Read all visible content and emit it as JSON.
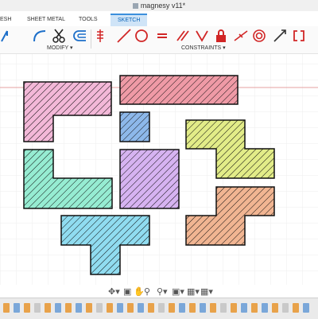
{
  "title": "magnesy v11*",
  "tabs": {
    "solid": "ESH",
    "sheet_metal": "SHEET METAL",
    "tools": "TOOLS",
    "sketch": "SKETCH"
  },
  "toolbar": {
    "modify_label": "MODIFY ▾",
    "constraints_label": "CONSTRAINTS ▾",
    "icons": [
      "line-icon",
      "arc-icon",
      "scissors-icon",
      "offset-icon",
      "pattern-icon",
      "circle-icon",
      "equal-icon",
      "parallel-icon",
      "perpendicular-icon",
      "lock-icon",
      "concentric-icon",
      "midpoint-icon",
      "symmetric-icon"
    ]
  },
  "colors": {
    "pink": "#f3b8d8",
    "red": "#ef9aa6",
    "blue_small": "#8db8ea",
    "yellow": "#e2ec88",
    "teal": "#96ecd2",
    "purple": "#d6b3f1",
    "cyan": "#90dcf0",
    "orange": "#f1b592",
    "hatch": "#0c0c0c",
    "axis": "#e4a0a0"
  },
  "canvas": {
    "shapes": [
      "pink-l-shape",
      "red-bar",
      "blue-square",
      "yellow-z-shape",
      "teal-l-shape",
      "purple-square",
      "cyan-t-shape",
      "orange-z-shape"
    ]
  },
  "navbar": {
    "icons": [
      "orbit-icon",
      "look-at-icon",
      "pan-icon",
      "zoom-icon",
      "zoom-window-icon",
      "display-settings-icon",
      "grid-icon",
      "viewports-icon"
    ]
  },
  "timeline": {
    "icons": [
      "timeline-feature-icon"
    ]
  }
}
